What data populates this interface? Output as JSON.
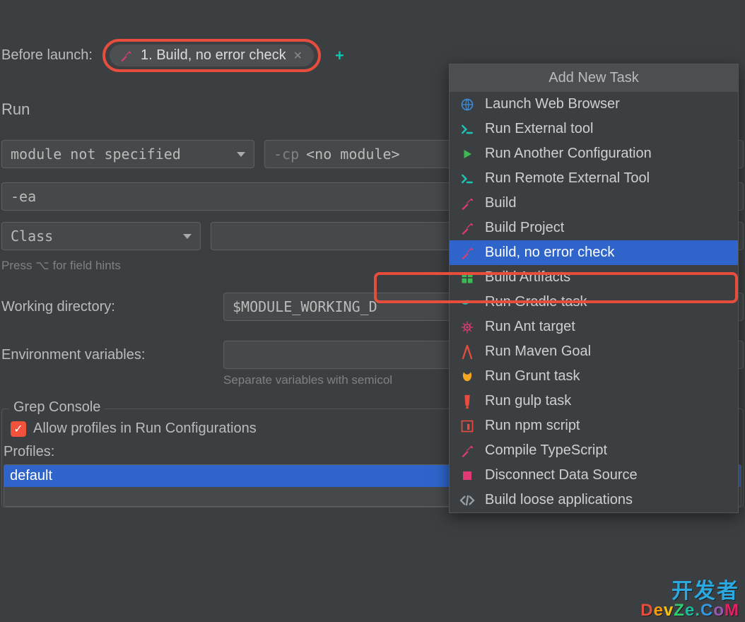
{
  "beforeLaunch": {
    "label": "Before launch:",
    "chip": "1. Build, no error check"
  },
  "runSection": {
    "heading": "Run",
    "moduleSelect": "module not specified",
    "cpPrefix": "-cp",
    "cpValue": "<no module>",
    "vmOptions": "-ea",
    "classSelect": "Class",
    "fieldHint": "Press ⌥ for field hints"
  },
  "workingDir": {
    "label": "Working directory:",
    "value": "$MODULE_WORKING_D"
  },
  "envVars": {
    "label": "Environment variables:",
    "hint": "Separate variables with semicol"
  },
  "grepConsole": {
    "legend": "Grep Console",
    "checkboxLabel": "Allow profiles in Run Configurations",
    "profilesLabel": "Profiles:",
    "profiles": [
      "default"
    ]
  },
  "taskPopup": {
    "title": "Add New Task",
    "items": [
      {
        "icon": "globe",
        "label": "Launch Web Browser"
      },
      {
        "icon": "terminal",
        "label": "Run External tool"
      },
      {
        "icon": "play",
        "label": "Run Another Configuration"
      },
      {
        "icon": "terminal",
        "label": "Run Remote External Tool"
      },
      {
        "icon": "hammer",
        "label": "Build"
      },
      {
        "icon": "hammer",
        "label": "Build Project"
      },
      {
        "icon": "hammer",
        "label": "Build, no error check",
        "selected": true
      },
      {
        "icon": "artifacts",
        "label": "Build Artifacts"
      },
      {
        "icon": "gradle",
        "label": "Run Gradle task"
      },
      {
        "icon": "ant",
        "label": "Run Ant target"
      },
      {
        "icon": "maven",
        "label": "Run Maven Goal"
      },
      {
        "icon": "grunt",
        "label": "Run Grunt task"
      },
      {
        "icon": "gulp",
        "label": "Run gulp task"
      },
      {
        "icon": "npm",
        "label": "Run npm script"
      },
      {
        "icon": "hammer",
        "label": "Compile TypeScript"
      },
      {
        "icon": "disconnect",
        "label": "Disconnect Data Source"
      },
      {
        "icon": "code",
        "label": "Build loose applications"
      }
    ]
  },
  "watermark": {
    "line1": "开发者",
    "line2": "DevZe.CoM"
  }
}
